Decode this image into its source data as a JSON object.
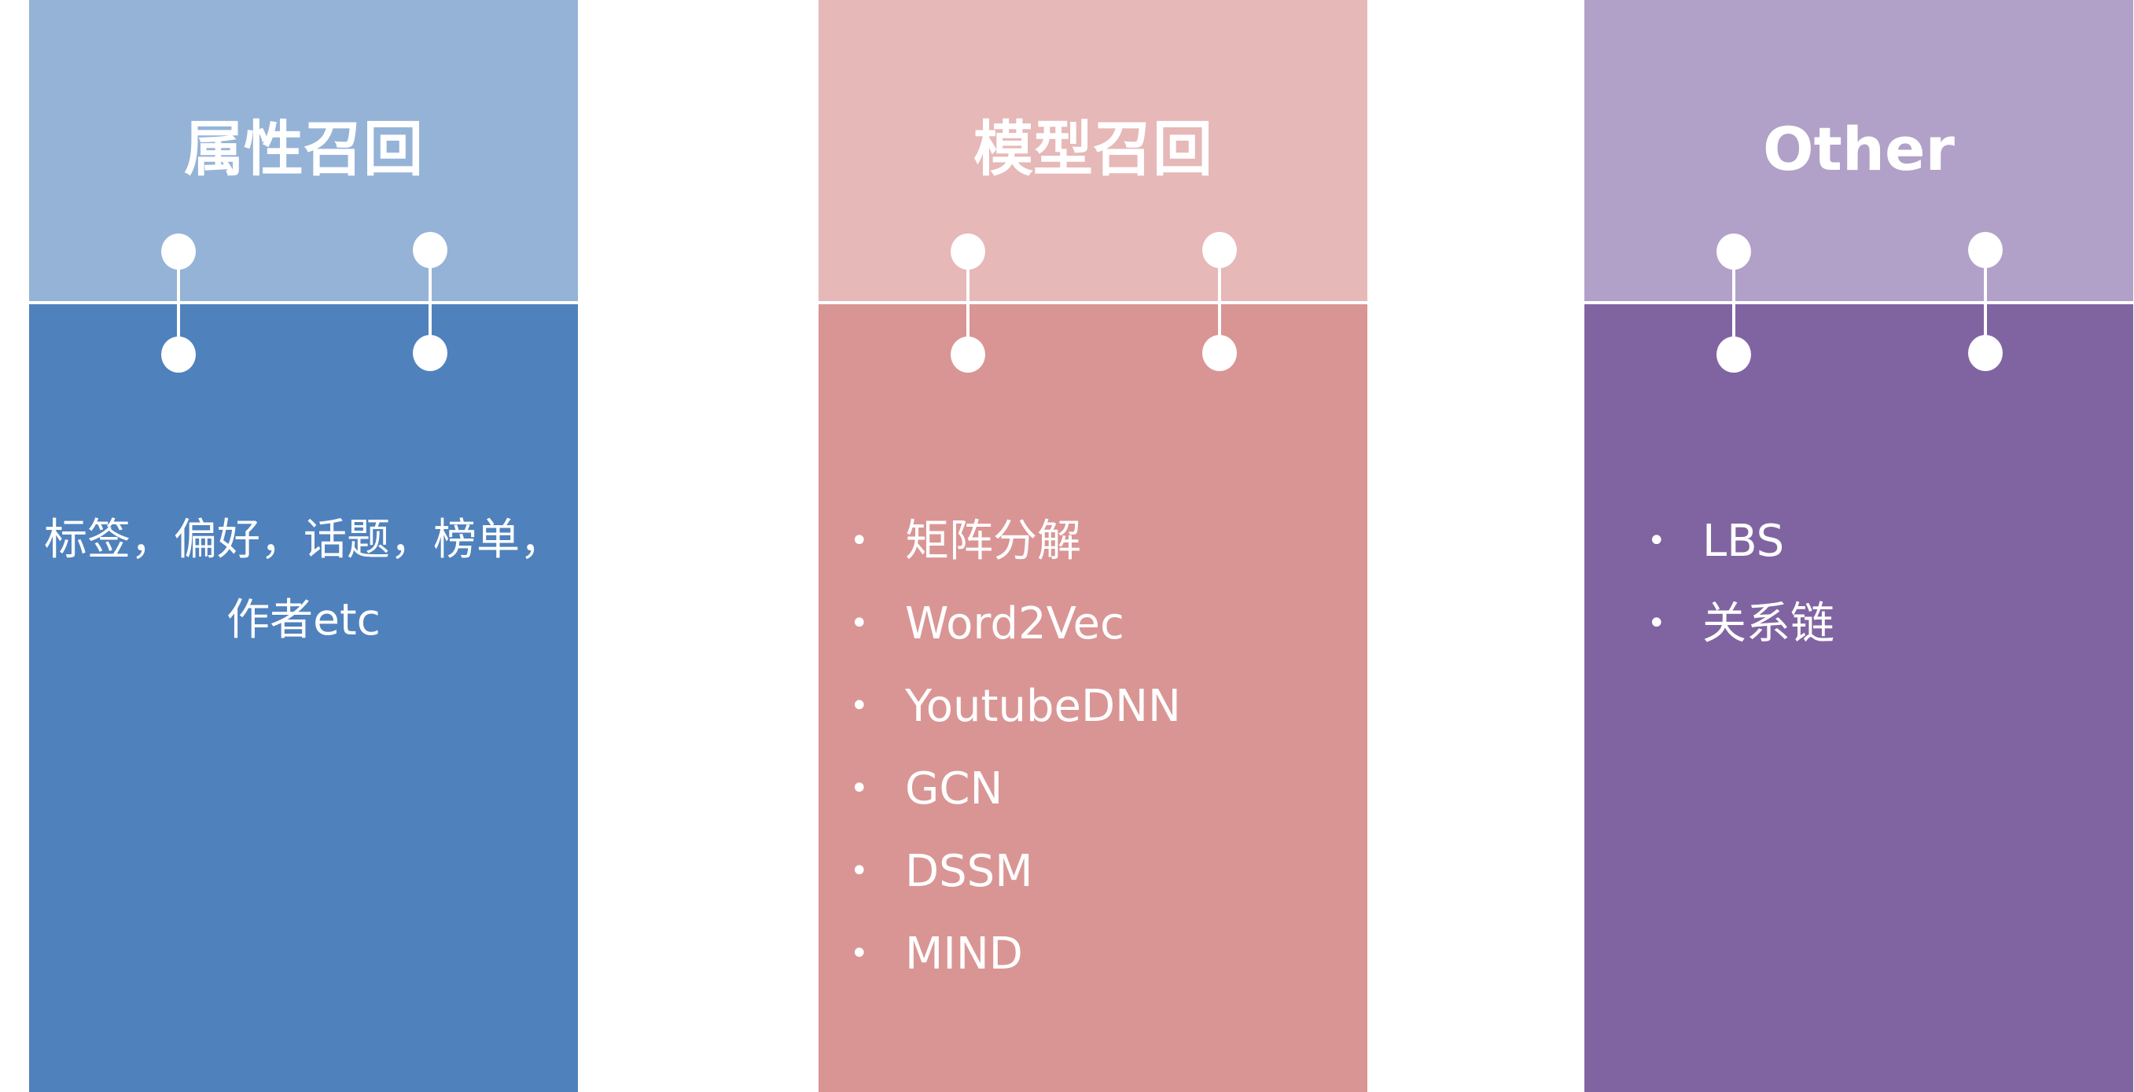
{
  "columns": [
    {
      "title": "属性召回",
      "colors": {
        "top": "#95b3d7",
        "bottom": "#4f81bd"
      },
      "text": "标签，偏好，话题，榜单，\n作者etc"
    },
    {
      "title": "模型召回",
      "colors": {
        "top": "#e6b8b7",
        "bottom": "#d99594"
      },
      "items": [
        "矩阵分解",
        "Word2Vec",
        "YoutubeDNN",
        "GCN",
        "DSSM",
        "MIND"
      ]
    },
    {
      "title": "Other",
      "colors": {
        "top": "#b1a0c7",
        "bottom": "#8064a2"
      },
      "items": [
        "LBS",
        "关系链"
      ]
    }
  ],
  "bullet_glyph": "•"
}
